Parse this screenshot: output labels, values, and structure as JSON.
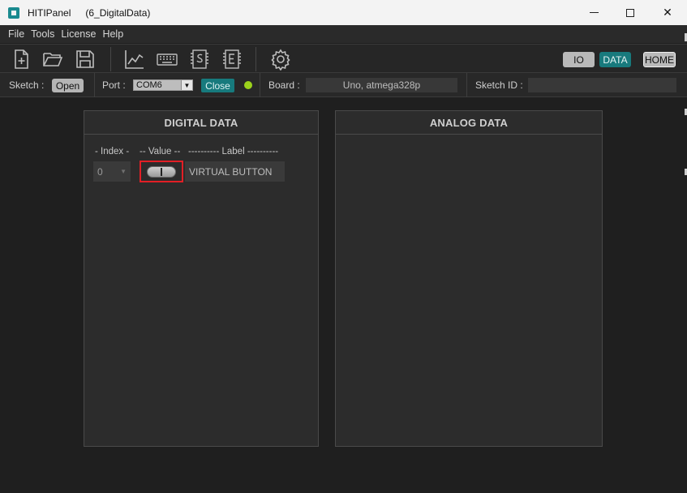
{
  "window": {
    "app_name": "HITIPanel",
    "document": "(6_DigitalData)"
  },
  "menu": [
    "File",
    "Tools",
    "License",
    "Help"
  ],
  "toolbar": {
    "icons": [
      "new-file-icon",
      "open-folder-icon",
      "save-icon",
      "chart-icon",
      "keyboard-icon",
      "sketch-s-icon",
      "sketch-e-icon",
      "gear-icon"
    ],
    "nav": {
      "io": "IO",
      "data": "DATA",
      "home": "HOME"
    }
  },
  "status": {
    "sketch_label": "Sketch :",
    "open_button": "Open",
    "port_label": "Port :",
    "port_value": "COM6",
    "close_button": "Close",
    "board_label": "Board :",
    "board_value": "Uno, atmega328p",
    "sketch_id_label": "Sketch ID :",
    "sketch_id_value": ""
  },
  "digital": {
    "title": "DIGITAL  DATA",
    "col_index": "- Index -",
    "col_value": "-- Value --",
    "col_label": "---------- Label ----------",
    "rows": [
      {
        "index": "0",
        "label": "VIRTUAL BUTTON"
      }
    ]
  },
  "analog": {
    "title": "ANALOG  DATA"
  },
  "colors": {
    "accent": "#187a7d",
    "led": "#9bd21b",
    "highlight": "#e21f26"
  }
}
